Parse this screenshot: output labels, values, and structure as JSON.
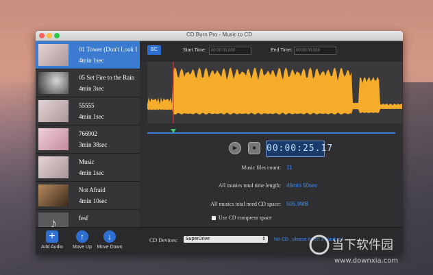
{
  "window": {
    "title": "CD Burn Pro - Music to CD"
  },
  "songs": [
    {
      "name": "01 Tower (Don't Look I",
      "duration": "4min 1sec",
      "selected": true,
      "thumb_color": "#c9b6b8"
    },
    {
      "name": "05 Set Fire to the Rain",
      "duration": "4min 3sec",
      "selected": false,
      "thumb_color": "#9b9b9b"
    },
    {
      "name": "55555",
      "duration": "4min 1sec",
      "selected": false,
      "thumb_color": "#c9b6b8"
    },
    {
      "name": "766902",
      "duration": "3min 38sec",
      "selected": false,
      "thumb_color": "#d7a9b6"
    },
    {
      "name": "Music",
      "duration": "4min 1sec",
      "selected": false,
      "thumb_color": "#c9b6b8"
    },
    {
      "name": "Not Afraid",
      "duration": "4min 10sec",
      "selected": false,
      "thumb_color": "#8a6a4a"
    },
    {
      "name": "fesf",
      "duration": "",
      "selected": false,
      "thumb_color": "#555555"
    }
  ],
  "timebar": {
    "bc_label": "BC",
    "start_label": "Start Time:",
    "start_value": "00:00:00.000",
    "end_label": "End Time:",
    "end_value": "00:00:00.000"
  },
  "player": {
    "time": "00:00:25.17",
    "play_icon": "▶",
    "stop_icon": "■"
  },
  "stats": {
    "count_label": "Music files count:",
    "count_value": "11",
    "length_label": "All musics total time length:",
    "length_value": "46min 50sec",
    "space_label": "All musics total need CD space:",
    "space_value": "505.9MB",
    "compress_label": "Use CD compress space"
  },
  "toolbar": {
    "add_label": "Add Audio",
    "up_label": "Move Up",
    "down_label": "Move Down",
    "cd_devices_label": "CD Devices:",
    "cd_device_value": "SuperDrive",
    "no_cd_text": "No CD , please insert a blank cd"
  },
  "colors": {
    "accent": "#3b7bd0",
    "waveform": "#f5ac2b",
    "cursor": "#e03030"
  }
}
